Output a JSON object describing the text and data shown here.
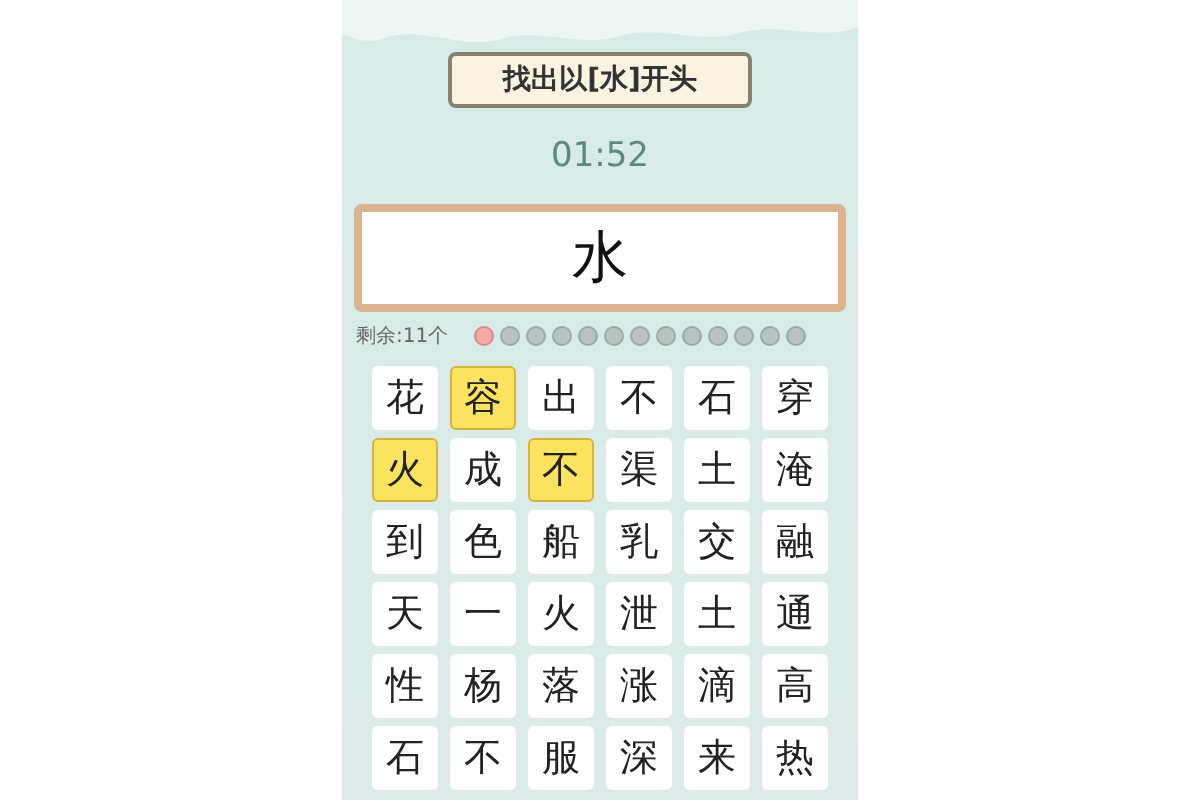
{
  "title": "找出以[水]开头",
  "timer": "01:52",
  "prompt": "水",
  "remaining": "剩余:11个",
  "progress": [
    {
      "selected": true
    },
    {
      "selected": false
    },
    {
      "selected": false
    },
    {
      "selected": false
    },
    {
      "selected": false
    },
    {
      "selected": false
    },
    {
      "selected": false
    },
    {
      "selected": false
    },
    {
      "selected": false
    },
    {
      "selected": false
    },
    {
      "selected": false
    },
    {
      "selected": false
    },
    {
      "selected": false
    }
  ],
  "grid": [
    [
      {
        "char": "花",
        "selected": false
      },
      {
        "char": "容",
        "selected": true
      },
      {
        "char": "出",
        "selected": false
      },
      {
        "char": "不",
        "selected": false
      },
      {
        "char": "石",
        "selected": false
      },
      {
        "char": "穿",
        "selected": false
      }
    ],
    [
      {
        "char": "火",
        "selected": true
      },
      {
        "char": "成",
        "selected": false
      },
      {
        "char": "不",
        "selected": true
      },
      {
        "char": "渠",
        "selected": false
      },
      {
        "char": "土",
        "selected": false
      },
      {
        "char": "淹",
        "selected": false
      }
    ],
    [
      {
        "char": "到",
        "selected": false
      },
      {
        "char": "色",
        "selected": false
      },
      {
        "char": "船",
        "selected": false
      },
      {
        "char": "乳",
        "selected": false
      },
      {
        "char": "交",
        "selected": false
      },
      {
        "char": "融",
        "selected": false
      }
    ],
    [
      {
        "char": "天",
        "selected": false
      },
      {
        "char": "一",
        "selected": false
      },
      {
        "char": "火",
        "selected": false
      },
      {
        "char": "泄",
        "selected": false
      },
      {
        "char": "土",
        "selected": false
      },
      {
        "char": "通",
        "selected": false
      }
    ],
    [
      {
        "char": "性",
        "selected": false
      },
      {
        "char": "杨",
        "selected": false
      },
      {
        "char": "落",
        "selected": false
      },
      {
        "char": "涨",
        "selected": false
      },
      {
        "char": "滴",
        "selected": false
      },
      {
        "char": "高",
        "selected": false
      }
    ],
    [
      {
        "char": "石",
        "selected": false
      },
      {
        "char": "不",
        "selected": false
      },
      {
        "char": "服",
        "selected": false
      },
      {
        "char": "深",
        "selected": false
      },
      {
        "char": "来",
        "selected": false
      },
      {
        "char": "热",
        "selected": false
      }
    ]
  ]
}
